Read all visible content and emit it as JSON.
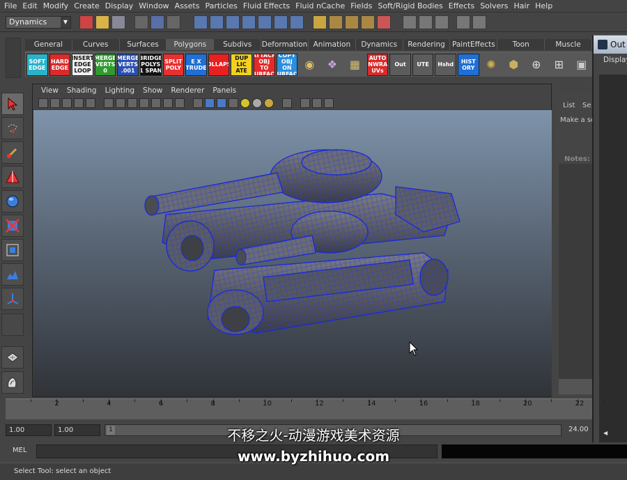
{
  "menu": [
    "File",
    "Edit",
    "Modify",
    "Create",
    "Display",
    "Window",
    "Assets",
    "Particles",
    "Fluid Effects",
    "Fluid nCache",
    "Fields",
    "Soft/Rigid Bodies",
    "Effects",
    "Solvers",
    "Hair",
    "Help"
  ],
  "status_line": {
    "mode": "Dynamics"
  },
  "shelf": {
    "tabs": [
      "General",
      "Curves",
      "Surfaces",
      "Polygons",
      "Subdivs",
      "Deformation",
      "Animation",
      "Dynamics",
      "Rendering",
      "PaintEffects",
      "Toon",
      "Muscle"
    ],
    "active_tab": "Polygons",
    "buttons": [
      {
        "lines": [
          "SOFT",
          "EDGE"
        ],
        "bg": "#2bb2c9",
        "fg": "#ffffff"
      },
      {
        "lines": [
          "HARD",
          "EDGE"
        ],
        "bg": "#d92b2b",
        "fg": "#ffffff"
      },
      {
        "lines": [
          "INSERT",
          "EDGE",
          "LOOP"
        ],
        "bg": "#f0f0f0",
        "fg": "#111111"
      },
      {
        "lines": [
          "MERGE",
          "VERTS",
          "0"
        ],
        "bg": "#2f9a2f",
        "fg": "#ffffff"
      },
      {
        "lines": [
          "MERGE",
          "VERTS",
          ".001"
        ],
        "bg": "#2a4fb0",
        "fg": "#ffffff"
      },
      {
        "lines": [
          "BRIDGE",
          "POLYS",
          "1 SPAN"
        ],
        "bg": "#111111",
        "fg": "#ffffff"
      },
      {
        "lines": [
          "SPLIT",
          "POLY"
        ],
        "bg": "#e83030",
        "fg": "#ffffff"
      },
      {
        "lines": [
          "E X",
          "TRUDE"
        ],
        "bg": "#1f6fd6",
        "fg": "#ffffff"
      },
      {
        "lines": [
          "COLLAPSE"
        ],
        "bg": "#e82020",
        "fg": "#ffffff"
      },
      {
        "lines": [
          "DUP",
          "LIC",
          "ATE"
        ],
        "bg": "#f2d21c",
        "fg": "#111111"
      },
      {
        "lines": [
          "ATTACH",
          "OBJ",
          "TO",
          "SURFACE"
        ],
        "bg": "#e22a2a",
        "fg": "#ffffff"
      },
      {
        "lines": [
          "COPY",
          "OBJ",
          "ON",
          "SURFACE"
        ],
        "bg": "#2a8fe0",
        "fg": "#ffffff"
      }
    ],
    "buttons2": [
      {
        "lines": [
          "AUTO",
          "UNWRAP",
          "UVs"
        ],
        "bg": "#d92b2b",
        "fg": "#ffffff"
      },
      {
        "lines": [
          "Out"
        ],
        "bg": "#5c5c5c",
        "fg": "#ffffff"
      },
      {
        "lines": [
          "UTE"
        ],
        "bg": "#5c5c5c",
        "fg": "#ffffff"
      },
      {
        "lines": [
          "Hshd"
        ],
        "bg": "#5c5c5c",
        "fg": "#ffffff"
      },
      {
        "lines": [
          "HIST",
          "ORY"
        ],
        "bg": "#1f6fd6",
        "fg": "#ffffff"
      }
    ]
  },
  "viewport": {
    "menu": [
      "View",
      "Shading",
      "Lighting",
      "Show",
      "Renderer",
      "Panels"
    ]
  },
  "right_panel": {
    "list_label": "List",
    "se_label": "Se",
    "make_label": "Make a se",
    "notes_label": "Notes:"
  },
  "outliner": {
    "title": "Out",
    "menu": "Display"
  },
  "time_slider": {
    "ticks": [
      "2",
      "4",
      "6",
      "8",
      "10",
      "12",
      "14",
      "16",
      "18",
      "20",
      "22"
    ]
  },
  "range": {
    "start_time": "1.00",
    "start_range": "1.00",
    "current": "1",
    "end_range": "24.00"
  },
  "command_line": {
    "label": "MEL"
  },
  "help_line": "Select Tool: select an object",
  "watermark": {
    "line1": "不移之火-动漫游戏美术资源",
    "line2": "www.byzhihuo.com"
  }
}
